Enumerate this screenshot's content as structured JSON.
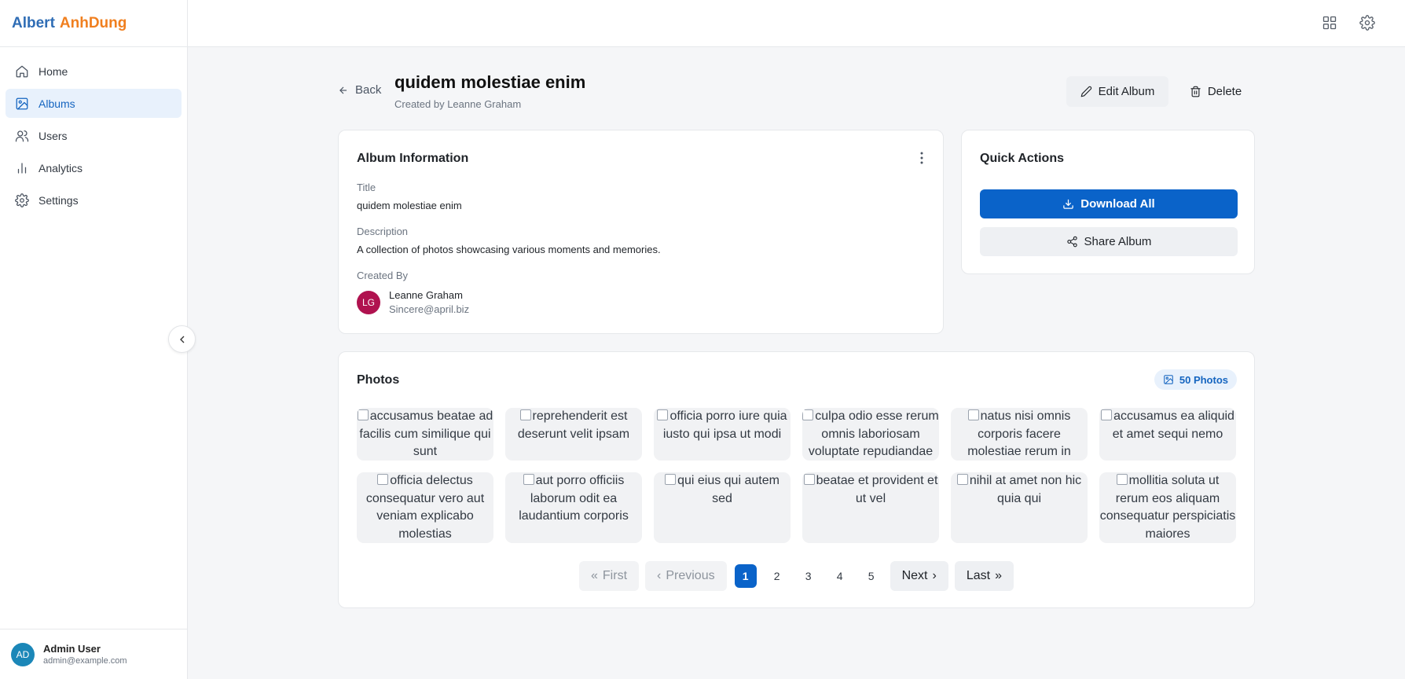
{
  "brand": {
    "part1": "Albert",
    "part2": "AnhDung"
  },
  "sidebar": {
    "items": [
      {
        "label": "Home",
        "icon": "home-icon"
      },
      {
        "label": "Albums",
        "icon": "image-icon",
        "active": true
      },
      {
        "label": "Users",
        "icon": "users-icon"
      },
      {
        "label": "Analytics",
        "icon": "bar-chart-icon"
      },
      {
        "label": "Settings",
        "icon": "gear-icon"
      }
    ],
    "user": {
      "initials": "AD",
      "name": "Admin User",
      "email": "admin@example.com"
    }
  },
  "header": {
    "back_label": "Back",
    "title": "quidem molestiae enim",
    "subtitle": "Created by Leanne Graham",
    "edit_label": "Edit Album",
    "delete_label": "Delete"
  },
  "album_info": {
    "heading": "Album Information",
    "title_label": "Title",
    "title_value": "quidem molestiae enim",
    "description_label": "Description",
    "description_value": "A collection of photos showcasing various moments and memories.",
    "created_by_label": "Created By",
    "creator": {
      "initials": "LG",
      "name": "Leanne Graham",
      "email": "Sincere@april.biz"
    }
  },
  "quick_actions": {
    "heading": "Quick Actions",
    "download_label": "Download All",
    "share_label": "Share Album"
  },
  "photos": {
    "heading": "Photos",
    "count_label": "50 Photos",
    "items": [
      "accusamus beatae ad facilis cum similique qui sunt",
      "reprehenderit est deserunt velit ipsam",
      "officia porro iure quia iusto qui ipsa ut modi",
      "culpa odio esse rerum omnis laboriosam voluptate repudiandae",
      "natus nisi omnis corporis facere molestiae rerum in",
      "accusamus ea aliquid et amet sequi nemo",
      "officia delectus consequatur vero aut veniam explicabo molestias",
      "aut porro officiis laborum odit ea laudantium corporis",
      "qui eius qui autem sed",
      "beatae et provident et ut vel",
      "nihil at amet non hic quia qui",
      "mollitia soluta ut rerum eos aliquam consequatur perspiciatis maiores"
    ]
  },
  "pagination": {
    "first_label": "First",
    "previous_label": "Previous",
    "pages": [
      "1",
      "2",
      "3",
      "4",
      "5"
    ],
    "current": "1",
    "next_label": "Next",
    "last_label": "Last"
  },
  "colors": {
    "primary": "#0a63c9",
    "brand_blue": "#2f6db5",
    "brand_orange": "#f07f1f",
    "active_bg": "#e8f1fc"
  }
}
